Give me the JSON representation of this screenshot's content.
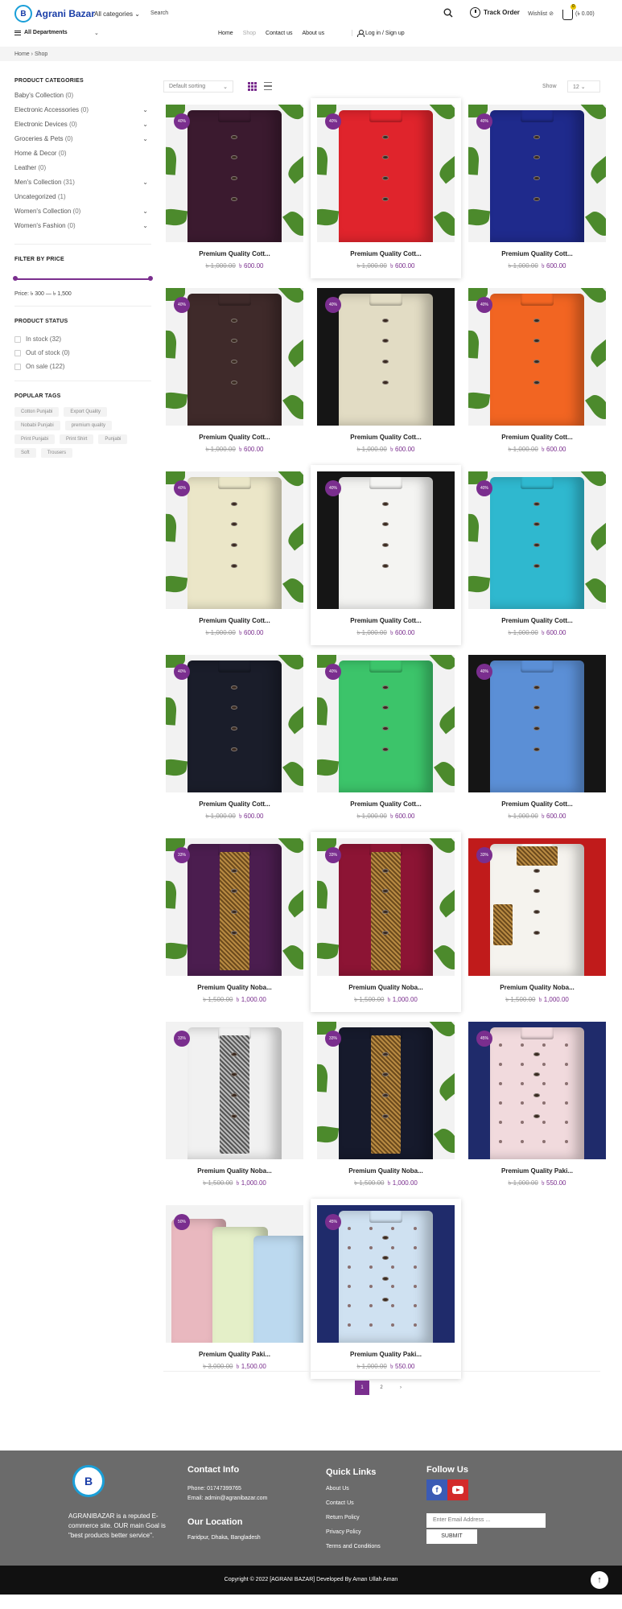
{
  "header": {
    "logo_text": "Agrani Bazar",
    "logo_mark": "B",
    "categories_label": "All categories",
    "search_placeholder": "Search",
    "track_order": "Track Order",
    "wishlist": "Wishlist",
    "wishlist_count": "0",
    "cart_total": "(৳ 0.00)",
    "cart_count": "0",
    "departments": "All Departments",
    "nav": [
      "Home",
      "Shop",
      "Contact us",
      "About us"
    ],
    "login": "Log in / Sign up"
  },
  "breadcrumb": {
    "home": "Home",
    "sep": "›",
    "current": "Shop"
  },
  "sidebar": {
    "categories_title": "PRODUCT CATEGORIES",
    "categories": [
      {
        "label": "Baby's Collection",
        "count": "(0)",
        "expandable": false
      },
      {
        "label": "Electronic Accessories",
        "count": "(0)",
        "expandable": true
      },
      {
        "label": "Electronic Devices",
        "count": "(0)",
        "expandable": true
      },
      {
        "label": "Groceries & Pets",
        "count": "(0)",
        "expandable": true
      },
      {
        "label": "Home & Decor",
        "count": "(0)",
        "expandable": false
      },
      {
        "label": "Leather",
        "count": "(0)",
        "expandable": false
      },
      {
        "label": "Men's Collection",
        "count": "(31)",
        "expandable": true
      },
      {
        "label": "Uncategorized",
        "count": "(1)",
        "expandable": false
      },
      {
        "label": "Women's Collection",
        "count": "(0)",
        "expandable": true
      },
      {
        "label": "Women's Fashion",
        "count": "(0)",
        "expandable": true
      }
    ],
    "price_title": "FILTER BY PRICE",
    "price_label": "Price: ৳ 300 — ৳ 1,500",
    "status_title": "PRODUCT STATUS",
    "status": [
      "In stock (32)",
      "Out of stock (0)",
      "On sale (122)"
    ],
    "tags_title": "POPULAR TAGS",
    "tags": [
      "Cotton Punjabi",
      "Export Quality",
      "Nobabi Punjabi",
      "premium quality",
      "Print Punjabi",
      "Print Shirt",
      "Punjabi",
      "Soft",
      "Trousers"
    ]
  },
  "toolbar": {
    "sort": "Default sorting",
    "show_label": "Show",
    "show_value": "12"
  },
  "products": [
    {
      "name": "Premium Quality Cott...",
      "old": "৳ 1,000.00",
      "new": "৳ 600.00",
      "badge": "40%",
      "color": "#3b1a2f",
      "style": "plain",
      "raised": false
    },
    {
      "name": "Premium Quality Cott...",
      "old": "৳ 1,000.00",
      "new": "৳ 600.00",
      "badge": "40%",
      "color": "#e0242c",
      "style": "plain",
      "raised": true
    },
    {
      "name": "Premium Quality Cott...",
      "old": "৳ 1,000.00",
      "new": "৳ 600.00",
      "badge": "40%",
      "color": "#1f2a8c",
      "style": "plain",
      "raised": false
    },
    {
      "name": "Premium Quality Cott...",
      "old": "৳ 1,000.00",
      "new": "৳ 600.00",
      "badge": "40%",
      "color": "#3f2a2a",
      "style": "plain",
      "raised": false
    },
    {
      "name": "Premium Quality Cott...",
      "old": "৳ 1,000.00",
      "new": "৳ 600.00",
      "badge": "40%",
      "color": "#e2dcc4",
      "style": "dark-bg",
      "raised": false
    },
    {
      "name": "Premium Quality Cott...",
      "old": "৳ 1,000.00",
      "new": "৳ 600.00",
      "badge": "40%",
      "color": "#f26522",
      "style": "plain",
      "raised": false
    },
    {
      "name": "Premium Quality Cott...",
      "old": "৳ 1,000.00",
      "new": "৳ 600.00",
      "badge": "40%",
      "color": "#ebe6c8",
      "style": "plain",
      "raised": false
    },
    {
      "name": "Premium Quality Cott...",
      "old": "৳ 1,000.00",
      "new": "৳ 600.00",
      "badge": "40%",
      "color": "#f4f4f2",
      "style": "dark-bg",
      "raised": true
    },
    {
      "name": "Premium Quality Cott...",
      "old": "৳ 1,000.00",
      "new": "৳ 600.00",
      "badge": "40%",
      "color": "#2fb8cf",
      "style": "plain",
      "raised": false
    },
    {
      "name": "Premium Quality Cott...",
      "old": "৳ 1,000.00",
      "new": "৳ 600.00",
      "badge": "40%",
      "color": "#1a1d2a",
      "style": "plain",
      "raised": false
    },
    {
      "name": "Premium Quality Cott...",
      "old": "৳ 1,000.00",
      "new": "৳ 600.00",
      "badge": "40%",
      "color": "#3cc46a",
      "style": "plain",
      "raised": false
    },
    {
      "name": "Premium Quality Cott...",
      "old": "৳ 1,000.00",
      "new": "৳ 600.00",
      "badge": "40%",
      "color": "#5b8fd6",
      "style": "dark-bg",
      "raised": false
    },
    {
      "name": "Premium Quality Noba...",
      "old": "৳ 1,500.00",
      "new": "৳ 1,000.00",
      "badge": "33%",
      "color": "#4b1d4f",
      "style": "embro",
      "raised": false
    },
    {
      "name": "Premium Quality Noba...",
      "old": "৳ 1,500.00",
      "new": "৳ 1,000.00",
      "badge": "33%",
      "color": "#8c1434",
      "style": "embro",
      "raised": true
    },
    {
      "name": "Premium Quality Noba...",
      "old": "৳ 1,500.00",
      "new": "৳ 1,000.00",
      "badge": "33%",
      "color": "#f5f3ee",
      "style": "embro-red",
      "raised": false
    },
    {
      "name": "Premium Quality Noba...",
      "old": "৳ 1,500.00",
      "new": "৳ 1,000.00",
      "badge": "33%",
      "color": "#f1f1f1",
      "style": "embro-silver",
      "raised": false
    },
    {
      "name": "Premium Quality Noba...",
      "old": "৳ 1,500.00",
      "new": "৳ 1,000.00",
      "badge": "33%",
      "color": "#161a2c",
      "style": "embro",
      "raised": false
    },
    {
      "name": "Premium Quality Paki...",
      "old": "৳ 1,000.00",
      "new": "৳ 550.00",
      "badge": "45%",
      "color": "#f1dadd",
      "style": "pattern",
      "raised": false
    },
    {
      "name": "Premium Quality Paki...",
      "old": "৳ 3,000.00",
      "new": "৳ 1,500.00",
      "badge": "50%",
      "color": "#e9b8bf",
      "style": "multi",
      "raised": false
    },
    {
      "name": "Premium Quality Paki...",
      "old": "৳ 1,000.00",
      "new": "৳ 550.00",
      "badge": "45%",
      "color": "#cfe1f1",
      "style": "pattern",
      "raised": true
    }
  ],
  "pagination": [
    "1",
    "2",
    "›"
  ],
  "footer": {
    "logo_mark": "B",
    "about": "AGRANIBAZAR is a reputed E-commerce site. OUR main Goal is \"best products better service\".",
    "contact_title": "Contact Info",
    "phone": "Phone: 01747399765",
    "email": "Email: admin@agranibazar.com",
    "location_title": "Our Location",
    "location": "Faridpur, Dhaka, Bangladesh",
    "links_title": "Quick Links",
    "links": [
      "About Us",
      "Contact Us",
      "Return Policy",
      "Privacy Policy",
      "Terms and Conditions"
    ],
    "follow_title": "Follow Us",
    "email_placeholder": "Enter Email Address ...",
    "submit": "SUBMIT",
    "copyright": "Copyright © 2022 [AGRANI BAZAR] Developed By Aman Ullah Aman",
    "to_top": "↑"
  },
  "colors": {
    "accent": "#7a2e8e",
    "footer_bg": "#6b6b6b",
    "copyright_bg": "#111111",
    "brand_blue": "#1a3ea8"
  }
}
